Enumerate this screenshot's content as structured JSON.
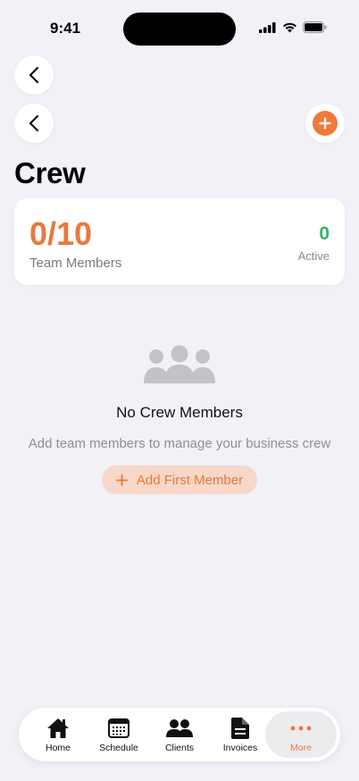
{
  "status_bar": {
    "time": "9:41"
  },
  "page": {
    "title": "Crew"
  },
  "stats": {
    "count": "0/10",
    "count_label": "Team Members",
    "active_value": "0",
    "active_label": "Active"
  },
  "empty_state": {
    "icon": "people-group-icon",
    "title": "No Crew Members",
    "subtitle": "Add team members to manage your business crew",
    "button_label": "Add First Member"
  },
  "tab_bar": {
    "items": [
      {
        "label": "Home",
        "icon": "home-icon"
      },
      {
        "label": "Schedule",
        "icon": "calendar-icon"
      },
      {
        "label": "Clients",
        "icon": "people-icon"
      },
      {
        "label": "Invoices",
        "icon": "document-icon"
      },
      {
        "label": "More",
        "icon": "ellipsis-icon"
      }
    ],
    "active": "More"
  },
  "colors": {
    "accent": "#e8793c",
    "active_green": "#34b561",
    "background": "#f2f1f7"
  }
}
